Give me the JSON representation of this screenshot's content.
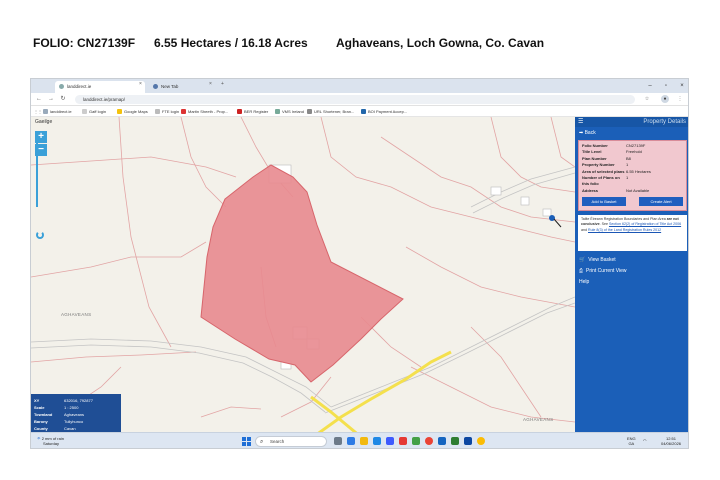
{
  "header": {
    "folio": "FOLIO: CN27139F",
    "area": "6.55 Hectares / 16.18 Acres",
    "location": "Aghaveans, Loch Gowna, Co. Cavan"
  },
  "browser": {
    "tabs": [
      {
        "label": "landdirect.ie",
        "active": true
      },
      {
        "label": "New Tab",
        "active": false
      }
    ],
    "url": "landdirect.ie/pramap/",
    "bookmarks": [
      "landdirect.ie",
      "Gaff login",
      "Google Maps",
      "FTE login",
      "Martin Sheeth - Prop...",
      "BER Register",
      "VMS Ireland",
      "URL Shortener, Bran...",
      "BOI Payment Accep..."
    ]
  },
  "map": {
    "language_link": "Gaeilge",
    "zoom_in": "+",
    "zoom_out": "−",
    "labels": [
      "AGHAVEANS",
      "AGHAVEANS"
    ],
    "info": {
      "xy_label": "XY",
      "xy_value": "632016, 792877",
      "scale_label": "Scale",
      "scale_value": "1 : 2500",
      "townland_label": "Townland",
      "townland_value": "Aghaveans",
      "barony_label": "Barony",
      "barony_value": "Tullyhunco",
      "county_label": "County",
      "county_value": "Cavan"
    }
  },
  "panel": {
    "title": "Property Details",
    "back": "Back",
    "property": {
      "folio_number_label": "Folio Number",
      "folio_number": "CN27139F",
      "title_level_label": "Title Level",
      "title_level": "Freehold",
      "plan_number_label": "Plan Number",
      "plan_number": "B8",
      "property_number_label": "Property Number",
      "property_number": "1",
      "area_label": "Area of selected plans",
      "area": "6.55 Hectares",
      "plans_count_label": "Number of Plans on this folio",
      "plans_count": "1",
      "address_label": "Address",
      "address": "Not Available"
    },
    "add_to_basket": "Add to Basket",
    "create_alert": "Create Alert",
    "notice_prefix": "Tailte Éireann Registration Boundaries and Plan Area ",
    "notice_bold": "are not conclusive",
    "notice_mid": ". See ",
    "notice_link1": "Section 62(2) of Registration of Title Act 2006",
    "notice_and": " and ",
    "notice_link2": "Rule 8(3) of the Land Registration Rules 2012",
    "view_basket": "View Basket",
    "print_view": "Print Current View",
    "help": "Help"
  },
  "taskbar": {
    "weather_line1": "2 mm of rain",
    "weather_line2": "Saturday",
    "search": "Search",
    "lang1": "ENG",
    "lang2": "GA",
    "time": "12:51",
    "date": "04/06/2026"
  },
  "colors": {
    "plot_fill": "#e88a8f",
    "panel_blue": "#1b5fb8",
    "road_yellow": "#f4e04d"
  }
}
